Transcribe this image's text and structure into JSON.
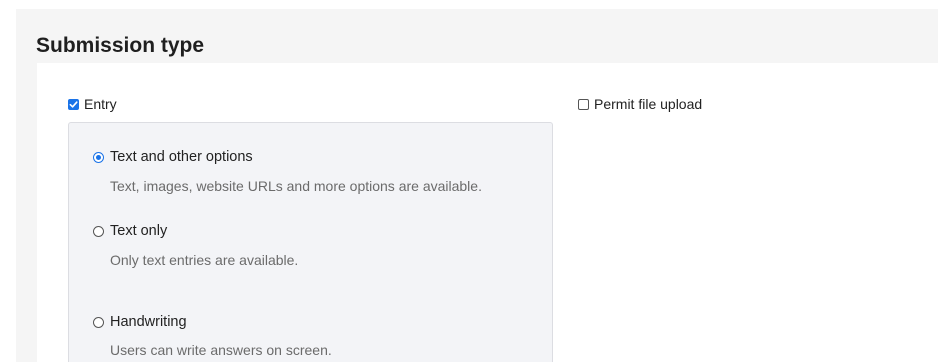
{
  "section": {
    "title": "Submission type"
  },
  "entry": {
    "label": "Entry",
    "checked": true
  },
  "permit_upload": {
    "label": "Permit file upload",
    "checked": false
  },
  "options": [
    {
      "label": "Text and other options",
      "description": "Text, images, website URLs and more options are available.",
      "selected": true
    },
    {
      "label": "Text only",
      "description": "Only text entries are available.",
      "selected": false
    },
    {
      "label": "Handwriting",
      "description": "Users can write answers on screen.",
      "selected": false
    }
  ],
  "colors": {
    "accent": "#1a73e8",
    "outer_background": "#f5f5f5",
    "options_background": "#f3f4f7",
    "description_text": "#6b6b6b"
  }
}
